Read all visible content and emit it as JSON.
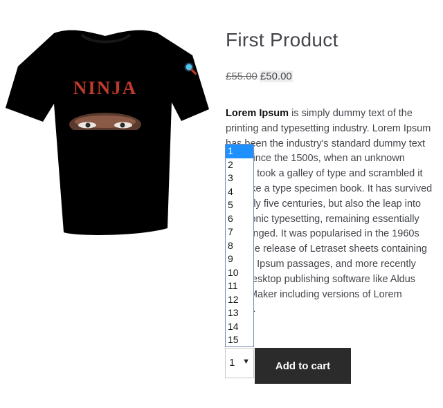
{
  "product": {
    "image_alt": "Black t-shirt with NINJA print",
    "shirt_print_text": "NINJA",
    "title": "First Product",
    "price_old": "£55.00",
    "price_new": "£50.00",
    "description_bold": "Lorem Ipsum",
    "description_rest": " is simply dummy text of the printing and typesetting industry. Lorem Ipsum has been the industry's standard dummy text ever since the 1500s, when an unknown printer took a galley of type and scrambled it to make a type specimen book. It has survived not only five centuries, but also the leap into electronic typesetting, remaining essentially unchanged. It was popularised in the 1960s with the release of Letraset sheets containing Lorem Ipsum passages, and more recently with desktop publishing software like Aldus PageMaker including versions of Lorem Ipsum."
  },
  "quantity": {
    "selected": "1",
    "options": [
      "1",
      "2",
      "3",
      "4",
      "5",
      "6",
      "7",
      "8",
      "9",
      "10",
      "11",
      "12",
      "13",
      "14",
      "15"
    ],
    "chevron": "▼"
  },
  "cart": {
    "button_label": "Add to cart"
  },
  "icons": {
    "zoom": "magnifier-icon"
  },
  "colors": {
    "button_bg": "#2b2b2b",
    "highlight": "#1e90ff",
    "text": "#43454b",
    "shirt": "#000000"
  }
}
